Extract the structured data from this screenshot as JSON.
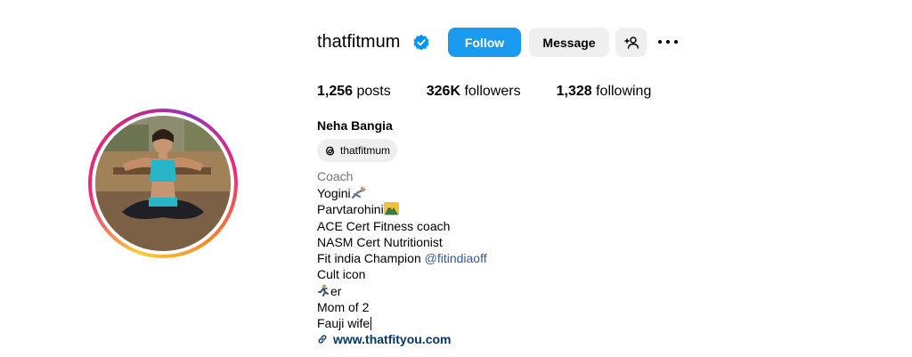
{
  "profile": {
    "username": "thatfitmum",
    "verified_icon": "verified-badge-icon",
    "full_name": "Neha Bangia",
    "threads_handle": "thatfitmum",
    "category": "Coach"
  },
  "actions": {
    "follow_label": "Follow",
    "message_label": "Message",
    "add_user_icon": "add-user-icon",
    "more_icon": "more-options-icon"
  },
  "stats": {
    "posts_count": "1,256",
    "posts_label": "posts",
    "followers_count": "326K",
    "followers_label": "followers",
    "following_count": "1,328",
    "following_label": "following"
  },
  "bio": {
    "line1": "Yogini",
    "line2": "Parvtarohini",
    "line3": "ACE Cert Fitness coach",
    "line4": "NASM Cert Nutritionist",
    "line5_text": "Fit india Champion ",
    "line5_mention": "@fitindiaoff",
    "line6": "Cult icon",
    "line7": "er",
    "line8": "Mom of 2",
    "line9": "Fauji wife"
  },
  "website": {
    "url_text": "www.thatfityou.com",
    "icon": "link-icon"
  },
  "colors": {
    "follow_blue": "#1a9bf0",
    "verified_blue": "#0095f6",
    "link_color": "#00376b",
    "mention_color": "#385898",
    "secondary_gray": "#737373"
  }
}
